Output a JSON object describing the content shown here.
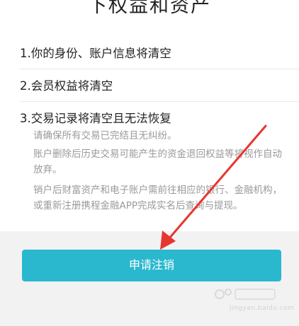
{
  "header": {
    "title": "下权益和资产"
  },
  "items": [
    {
      "label": "1.你的身份、账户信息将清空"
    },
    {
      "label": "2.会员权益将清空"
    },
    {
      "label": "3.交易记录将清空且无法恢复"
    }
  ],
  "details": [
    "请确保所有交易已完结且无纠纷。",
    "账户删除后历史交易可能产生的资金退回权益等将视作自动放弃。",
    "销户后财富资产和电子账户需前往相应的银行、金融机构，或重新注册携程金融APP完成实名后查询与提现。"
  ],
  "footer": {
    "button_label": "申请注销"
  },
  "watermark": {
    "text": "jingyan.baidu.com"
  },
  "colors": {
    "accent": "#2ab8cf",
    "arrow": "#e8352f",
    "footer_bg": "#f2f2f2"
  },
  "icons": {
    "annotation": "red-arrow-icon",
    "watermark": "baidu-jingyan-logo"
  }
}
